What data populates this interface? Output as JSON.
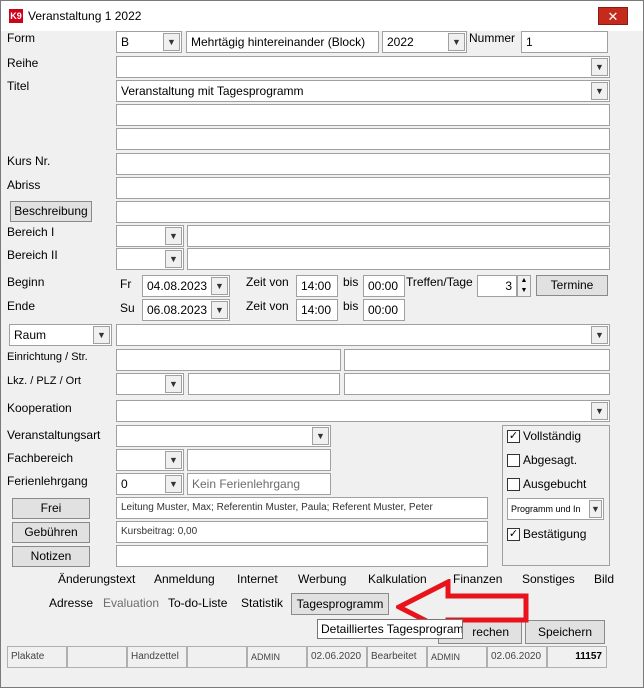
{
  "window": {
    "title": "Veranstaltung 1 2022",
    "app_icon": "K9",
    "close_symbol": "✕"
  },
  "labels": {
    "form": "Form",
    "nummer": "Nummer",
    "reihe": "Reihe",
    "titel": "Titel",
    "kurs_nr": "Kurs Nr.",
    "abriss": "Abriss",
    "bereich1": "Bereich I",
    "bereich2": "Bereich II",
    "beginn": "Beginn",
    "ende": "Ende",
    "zeit_von": "Zeit von",
    "bis": "bis",
    "treffen_tage": "Treffen/Tage",
    "einrichtung": "Einrichtung / Str.",
    "lkz_plz_ort": "Lkz. / PLZ / Ort",
    "kooperation": "Kooperation",
    "veranstaltungsart": "Veranstaltungsart",
    "fachbereich": "Fachbereich",
    "ferienlehrgang": "Ferienlehrgang"
  },
  "fields": {
    "form_value": "B",
    "form_desc": "Mehrtägig hintereinander (Block)",
    "year": "2022",
    "nummer": "1",
    "titel": "Veranstaltung mit Tagesprogramm",
    "beginn_day": "Fr",
    "beginn_date": "04.08.2023",
    "beginn_time_from": "14:00",
    "beginn_time_to": "00:00",
    "ende_day": "Su",
    "ende_date": "06.08.2023",
    "ende_time_from": "14:00",
    "ende_time_to": "00:00",
    "treffen": "3",
    "raum": "Raum",
    "ferien_value": "0",
    "ferien_desc": "Kein Ferienlehrgang",
    "frei_text": "Leitung Muster, Max; Referentin Muster, Paula; Referent Muster, Peter",
    "gebuehren_text": "Kursbeitrag: 0,00",
    "programm_select": "Programm und In"
  },
  "buttons": {
    "beschreibung": "Beschreibung",
    "termine": "Termine",
    "frei": "Frei",
    "gebuehren": "Gebühren",
    "notizen": "Notizen",
    "rechen": "rechen",
    "speichern": "Speichern"
  },
  "checkboxes": {
    "vollstaendig": {
      "label": "Vollständig",
      "checked": "✓"
    },
    "abgesagt": {
      "label": "Abgesagt.",
      "checked": ""
    },
    "ausgebucht": {
      "label": "Ausgebucht",
      "checked": ""
    },
    "bestaetigung": {
      "label": "Bestätigung",
      "checked": "✓"
    }
  },
  "links_row1": [
    "Änderungstext",
    "Anmeldung",
    "Internet",
    "Werbung",
    "Kalkulation",
    "Finanzen",
    "Sonstiges",
    "Bild"
  ],
  "links_row2": {
    "adresse": "Adresse",
    "evaluation": "Evaluation",
    "todo": "To-do-Liste",
    "statistik": "Statistik",
    "tagesprogramm": "Tagesprogramm"
  },
  "tooltip": "Detailliertes Tagesprogramm",
  "statusbar": {
    "plakate": "Plakate",
    "handzettel": "Handzettel",
    "admin1": "ADMIN",
    "date1": "02.06.2020",
    "bearbeitet": "Bearbeitet",
    "admin2": "ADMIN",
    "date2": "02.06.2020",
    "id": "11157"
  },
  "colors": {
    "arrow": "#e8131b",
    "close": "#c42b1c"
  }
}
